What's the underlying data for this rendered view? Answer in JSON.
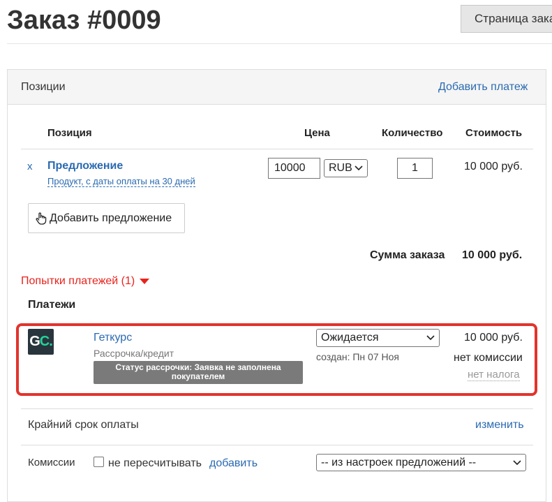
{
  "header": {
    "title": "Заказ #0009",
    "view_page_label": "Страница заказа"
  },
  "positions": {
    "panel_title": "Позиции",
    "add_payment_label": "Добавить платеж",
    "columns": {
      "position": "Позиция",
      "price": "Цена",
      "quantity": "Количество",
      "cost": "Стоимость"
    },
    "items": [
      {
        "remove_label": "x",
        "title": "Предложение",
        "subtitle": "Продукт, с даты оплаты на 30 дней",
        "price": "10000",
        "currency": "RUB",
        "quantity": "1",
        "cost": "10 000 руб."
      }
    ],
    "add_offer_label": "Добавить предложение",
    "order_sum_label": "Сумма заказа",
    "order_sum_value": "10 000 руб."
  },
  "payment_attempts": {
    "label": "Попытки платежей (1)"
  },
  "payments": {
    "title": "Платежи",
    "items": [
      {
        "logo_text_main": "G",
        "logo_text_accent": "C.",
        "provider": "Геткурс",
        "method": "Рассрочка/кредит",
        "status_note": "Статус рассрочки: Заявка не заполнена покупателем",
        "status": "Ожидается",
        "created": "создан: Пн 07 Ноя",
        "amount": "10 000 руб.",
        "fee": "нет комиссии",
        "tax": "нет налога"
      }
    ]
  },
  "deadline": {
    "label": "Крайний срок оплаты",
    "change_label": "изменить"
  },
  "fees": {
    "label": "Комиссии",
    "no_recalc_label": "не пересчитывать",
    "add_label": "добавить",
    "settings_value": "-- из настроек предложений --"
  },
  "colors": {
    "link": "#2a6ab1",
    "alert_red": "#e8231d",
    "highlight": "#e2342d",
    "logo_bg": "#29353d",
    "logo_accent": "#22d39a"
  }
}
